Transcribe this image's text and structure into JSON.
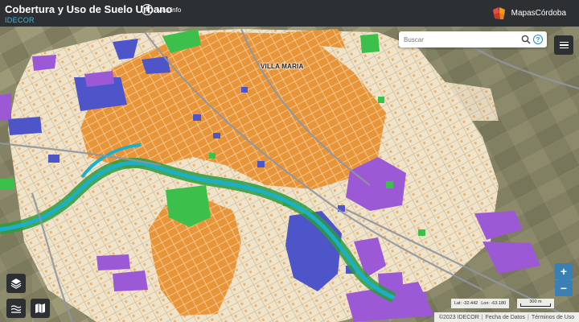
{
  "header": {
    "title": "Cobertura y Uso de Suelo Urbano",
    "subtitle": "IDECOR",
    "info_label": "Más info",
    "brand": "MapasCórdoba"
  },
  "search": {
    "placeholder": "Buscar"
  },
  "map": {
    "city_label": "VILLA MARIA",
    "coords": {
      "lat": "Lat: -32.442",
      "lon": "Lon: -63.180"
    },
    "scale_label": "300 m",
    "colors": {
      "urban_residential": "#e8953a",
      "low_density": "#efe3c9",
      "industrial": "#9b59d6",
      "institutional": "#4d55c9",
      "green_space": "#3cbf4b",
      "water": "#1cb0c8",
      "cropland": "#8c8a6a"
    }
  },
  "attribution": {
    "copyright": "©2023 IDECOR",
    "data_link": "Fecha de Datos",
    "terms_link": "Términos de Uso"
  },
  "zoom": {
    "in": "+",
    "out": "−"
  }
}
